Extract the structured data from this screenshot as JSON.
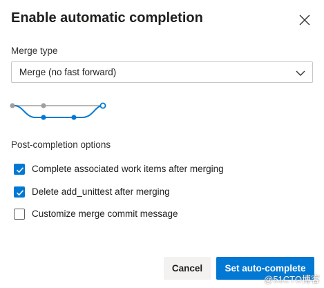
{
  "dialog": {
    "title": "Enable automatic completion",
    "close_icon": "close-icon"
  },
  "merge_type": {
    "label": "Merge type",
    "selected": "Merge (no fast forward)",
    "dropdown_icon": "chevron-down-icon"
  },
  "diagram": {
    "icon": "merge-graph-icon",
    "colors": {
      "base": "#a19f9d",
      "branch": "#0078d4"
    }
  },
  "post_completion": {
    "label": "Post-completion options",
    "options": [
      {
        "label": "Complete associated work items after merging",
        "checked": true
      },
      {
        "label": "Delete add_unittest after merging",
        "checked": true
      },
      {
        "label": "Customize merge commit message",
        "checked": false
      }
    ]
  },
  "buttons": {
    "cancel": "Cancel",
    "primary": "Set auto-complete"
  },
  "watermark": "@51CTO博客",
  "colors": {
    "accent": "#0078d4",
    "secondary_button": "#f3f2f1"
  }
}
